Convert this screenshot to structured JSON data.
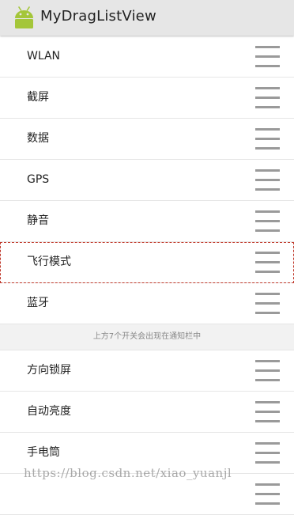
{
  "app": {
    "title": "MyDragListView",
    "icon": "android-icon"
  },
  "list": {
    "items_top": [
      {
        "label": "WLAN"
      },
      {
        "label": "截屏"
      },
      {
        "label": "数据"
      },
      {
        "label": "GPS"
      },
      {
        "label": "静音"
      },
      {
        "label": "飞行模式",
        "dragging": true
      },
      {
        "label": "蓝牙"
      }
    ],
    "divider_text": "上方7个开关会出现在通知栏中",
    "items_bottom": [
      {
        "label": "方向锁屏"
      },
      {
        "label": "自动亮度"
      },
      {
        "label": "手电筒"
      }
    ],
    "handle_icon": "drag-handle-icon"
  },
  "watermark": "https://blog.csdn.net/xiao_yuanjl",
  "colors": {
    "appbar": "#e6e6e6",
    "android_green": "#a4c639",
    "drag_outline": "#c0392b",
    "handle": "#9a9a9a"
  }
}
